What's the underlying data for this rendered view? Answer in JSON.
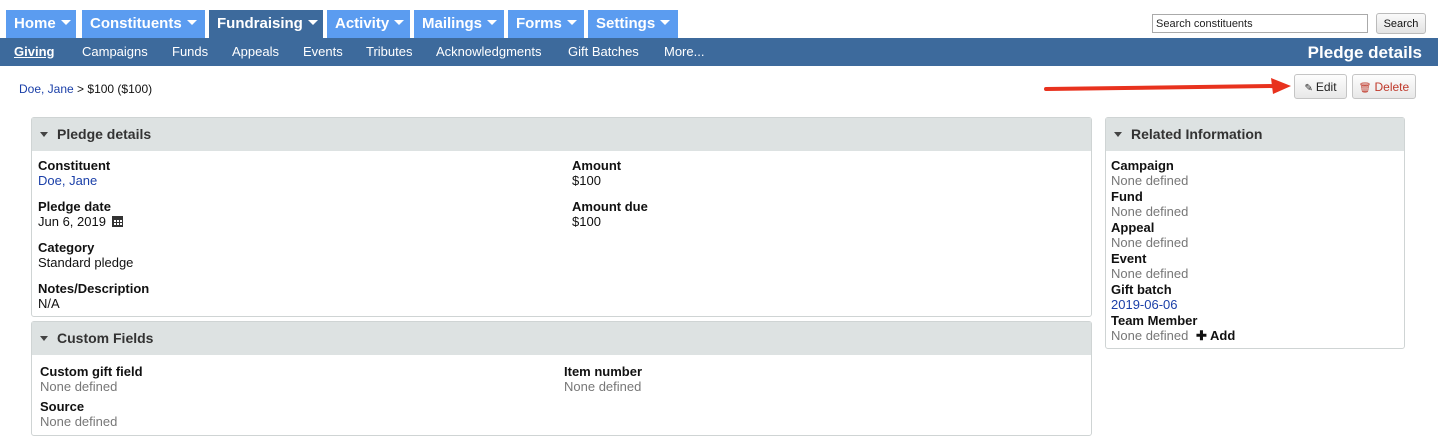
{
  "nav": {
    "tabs": [
      {
        "label": "Home"
      },
      {
        "label": "Constituents"
      },
      {
        "label": "Fundraising"
      },
      {
        "label": "Activity"
      },
      {
        "label": "Mailings"
      },
      {
        "label": "Forms"
      },
      {
        "label": "Settings"
      }
    ],
    "active_tab": "Fundraising",
    "search_placeholder": "Search constituents",
    "search_button": "Search"
  },
  "subnav": {
    "items": [
      "Giving",
      "Campaigns",
      "Funds",
      "Appeals",
      "Events",
      "Tributes",
      "Acknowledgments",
      "Gift Batches",
      "More..."
    ],
    "active": "Giving",
    "page_title": "Pledge details"
  },
  "breadcrumb": {
    "link": "Doe, Jane",
    "separator": ">",
    "current": "$100 ($100)"
  },
  "actions": {
    "edit": "Edit",
    "delete": "Delete"
  },
  "pledge_details": {
    "title": "Pledge details",
    "constituent_label": "Constituent",
    "constituent_value": "Doe, Jane",
    "amount_label": "Amount",
    "amount_value": "$100",
    "pledge_date_label": "Pledge date",
    "pledge_date_value": "Jun 6, 2019",
    "amount_due_label": "Amount due",
    "amount_due_value": "$100",
    "category_label": "Category",
    "category_value": "Standard pledge",
    "notes_label": "Notes/Description",
    "notes_value": "N/A"
  },
  "custom_fields": {
    "title": "Custom Fields",
    "custom_gift_label": "Custom gift field",
    "custom_gift_value": "None defined",
    "item_number_label": "Item number",
    "item_number_value": "None defined",
    "source_label": "Source",
    "source_value": "None defined"
  },
  "related": {
    "title": "Related Information",
    "campaign_label": "Campaign",
    "campaign_value": "None defined",
    "fund_label": "Fund",
    "fund_value": "None defined",
    "appeal_label": "Appeal",
    "appeal_value": "None defined",
    "event_label": "Event",
    "event_value": "None defined",
    "gift_batch_label": "Gift batch",
    "gift_batch_value": "2019-06-06",
    "team_member_label": "Team Member",
    "team_member_value": "None defined",
    "add_label": "Add"
  },
  "colors": {
    "tab_blue": "#5b9cf0",
    "nav_dark": "#3d6a9c",
    "link": "#1a3fa8",
    "annotation_arrow": "#e8321e",
    "delete_red": "#c0392b"
  }
}
